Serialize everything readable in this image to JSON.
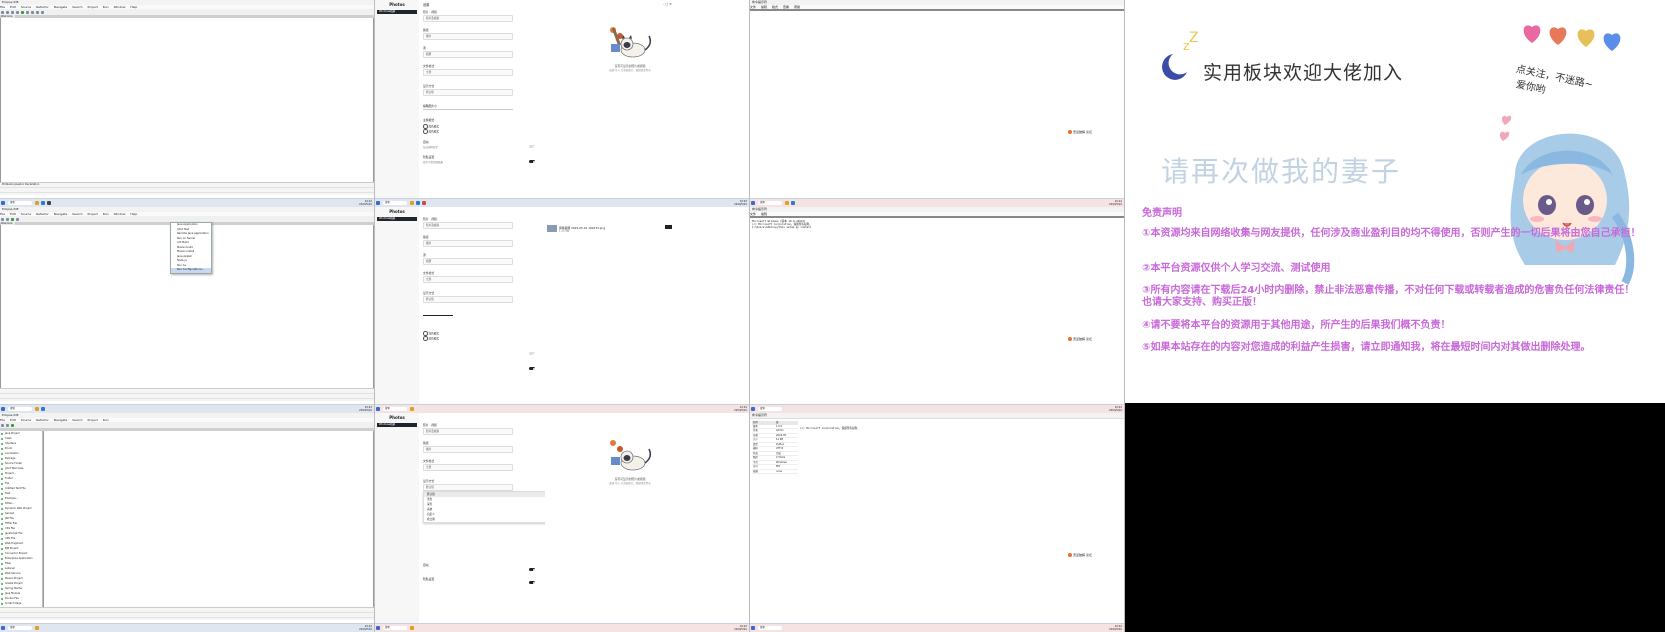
{
  "ide": {
    "title": "Eclipse IDE",
    "menu": [
      "File",
      "Edit",
      "Source",
      "Refactor",
      "Navigate",
      "Search",
      "Project",
      "Run",
      "Window",
      "Help"
    ],
    "tab_label": "Welcome",
    "status_items": [
      "Console",
      "Problems",
      "Progress"
    ],
    "search_placeholder": "搜索",
    "dropdown_items": [
      "Java Application",
      "JUnit Test",
      "Remote Java Application",
      "Run on Server",
      "Ant Build",
      "Maven build",
      "Maven install",
      "Java Applet",
      "Node.js",
      "Run As",
      "Run Configurations..."
    ],
    "sidelist_items": [
      "Java Project",
      "Class",
      "Interface",
      "Enum",
      "Annotation",
      "Package",
      "Source Folder",
      "JUnit Test Case",
      "Project...",
      "Folder",
      "File",
      "Untitled Text File",
      "Task",
      "Example...",
      "Other...",
      "Dynamic Web Project",
      "Servlet",
      "JSP File",
      "HTML File",
      "CSS File",
      "JavaScript File",
      "XML File",
      "Web Fragment",
      "EJB Project",
      "Connector Project",
      "Enterprise Application",
      "Filter",
      "Listener",
      "Web Service",
      "Maven Project",
      "Gradle Project",
      "Spring Starter",
      "Java Module",
      "Docker File",
      "Scratch Page",
      "Record",
      "Script",
      "Test Suite"
    ],
    "bottom_tabs": [
      "Problems",
      "Javadoc",
      "Declaration"
    ]
  },
  "photos": {
    "app_title": "Photos",
    "nav_item": "Windows相册",
    "settings": {
      "section_title": "设置",
      "app_version": "版本 2024",
      "fields": [
        {
          "label": "照片 · 视频",
          "value": "照片及视频"
        },
        {
          "label": "路径",
          "value": "图片"
        },
        {
          "label": "源",
          "value": "相册"
        },
        {
          "label": "文件格式",
          "value": "全部"
        },
        {
          "label": "显示方式",
          "value": "默认值"
        },
        {
          "label": "主题模式",
          "value": ""
        }
      ],
      "slider_label": "缩略图大小",
      "radio_options": [
        "浅色模式",
        "深色模式"
      ],
      "toggle_1_label": "自动",
      "toggle_1_desc": "在启动时显示",
      "toggle_2_label": "隐私设置",
      "toggle_2_desc": "显示人脸识别结果",
      "dropdown_options": [
        "默认值",
        "浅色",
        "深色",
        "系统",
        "自定义",
        "按日期"
      ]
    },
    "empty_state": {
      "line1": "没有可显示的照片或视频",
      "line2": "选择 导入 以添加照片、视频或文件夹"
    },
    "file_item": "屏幕截图 2024-05-10 102233.png",
    "file_meta": "1.25 MB"
  },
  "terminal": {
    "title": "命令提示符",
    "menu": [
      "文件",
      "编辑",
      "格式",
      "查看",
      "帮助"
    ],
    "lines": [
      "Microsoft Windows [版本 10.0.22631]",
      "(c) Microsoft Corporation。保留所有权利。",
      "C:\\Users\\Admin>python setup.py install"
    ],
    "table_headers": [
      "名称",
      "值"
    ],
    "table_rows": [
      [
        "版本",
        "1.0.2"
      ],
      [
        "作者",
        "Admin"
      ],
      [
        "日期",
        "2024-05"
      ],
      [
        "大小",
        "12 KB"
      ],
      [
        "类型",
        "Python"
      ],
      [
        "编码",
        "UTF-8"
      ],
      [
        "状态",
        "完成"
      ],
      [
        "路径",
        "C:\\Tools"
      ],
      [
        "平台",
        "Windows"
      ],
      [
        "许可",
        "MIT"
      ],
      [
        "依赖",
        "none"
      ]
    ]
  },
  "brand_text": "吾爱破解 论坛",
  "taskbar": {
    "search": "搜索",
    "time": "10:22",
    "date": "2024/5/10"
  },
  "promo": {
    "headline": "实用板块欢迎大佬加入",
    "sidenote": "点关注，不迷路~\n 爱你哟",
    "faint_text": "请再次做我的妻子",
    "disclaimer_title": "免责声明",
    "paragraphs": [
      "①本资源均来自网络收集与网友提供，任何涉及商业盈利目的均不得使用，否则产生的一切后果将由您自己承担！",
      "②本平台资源仅供个人学习交流、测试使用",
      "③所有内容请在下载后24小时内删除，禁止非法恶意传播，不对任何下载或转载者造成的危害负任何法律责任！也请大家支持、购买正版！",
      "④请不要将本平台的资源用于其他用途，所产生的后果我们概不负责！",
      "⑤如果本站存在的内容对您造成的利益产生损害，请立即通知我，将在最短时间内对其做出删除处理。"
    ],
    "colors": {
      "text": "#c86ad8",
      "heart1": "#e86aa0",
      "heart2": "#e8785a",
      "heart3": "#e8c05a",
      "heart4": "#5a8ee8",
      "moon": "#3a4ca8",
      "zz": "#e8c84a"
    }
  }
}
